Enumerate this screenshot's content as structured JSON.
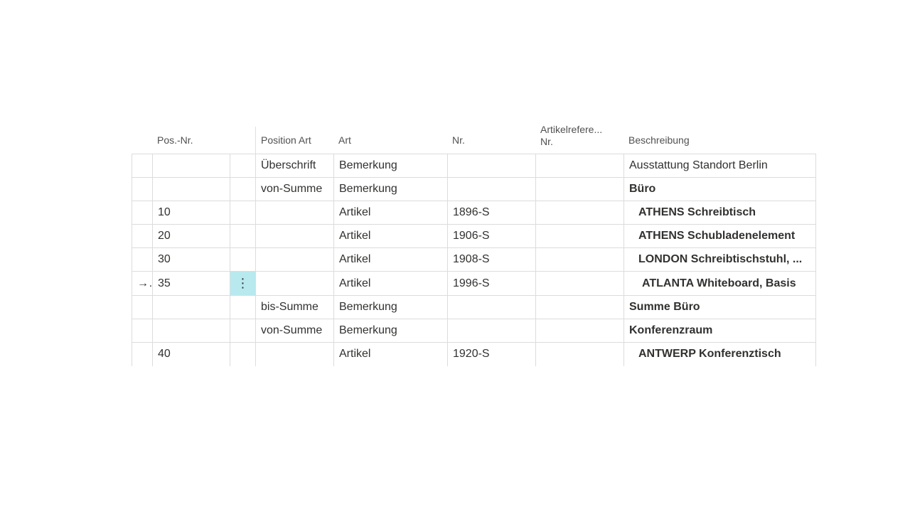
{
  "columns": {
    "pos_nr": "Pos.-Nr.",
    "position_art": "Position Art",
    "art": "Art",
    "nr": "Nr.",
    "artikelreferenz_line1": "Artikelrefere...",
    "artikelreferenz_line2": "Nr.",
    "beschreibung": "Beschreibung"
  },
  "rows": [
    {
      "pos": "",
      "position_art": "Überschrift",
      "art": "Bemerkung",
      "nr": "",
      "ref": "",
      "beschreibung": "Ausstattung Standort Berlin"
    },
    {
      "pos": "",
      "position_art": "von-Summe",
      "art": "Bemerkung",
      "nr": "",
      "ref": "",
      "beschreibung": "Büro"
    },
    {
      "pos": "10",
      "position_art": "",
      "art": "Artikel",
      "nr": "1896-S",
      "ref": "",
      "beschreibung": "ATHENS Schreibtisch"
    },
    {
      "pos": "20",
      "position_art": "",
      "art": "Artikel",
      "nr": "1906-S",
      "ref": "",
      "beschreibung": "ATHENS Schubladenelement"
    },
    {
      "pos": "30",
      "position_art": "",
      "art": "Artikel",
      "nr": "1908-S",
      "ref": "",
      "beschreibung": "LONDON Schreibtischstuhl, ..."
    },
    {
      "pos": "35",
      "position_art": "",
      "art": "Artikel",
      "nr": "1996-S",
      "ref": "",
      "beschreibung": "ATLANTA Whiteboard, Basis",
      "current_indicator": "→",
      "menu": "⋮"
    },
    {
      "pos": "",
      "position_art": "bis-Summe",
      "art": "Bemerkung",
      "nr": "",
      "ref": "",
      "beschreibung": "Summe Büro"
    },
    {
      "pos": "",
      "position_art": "von-Summe",
      "art": "Bemerkung",
      "nr": "",
      "ref": "",
      "beschreibung": "Konferenzraum"
    },
    {
      "pos": "40",
      "position_art": "",
      "art": "Artikel",
      "nr": "1920-S",
      "ref": "",
      "beschreibung": "ANTWERP Konferenztisch"
    }
  ],
  "colors": {
    "accent_teal": "#00807f",
    "selected_cell": "#b7e9ef"
  }
}
